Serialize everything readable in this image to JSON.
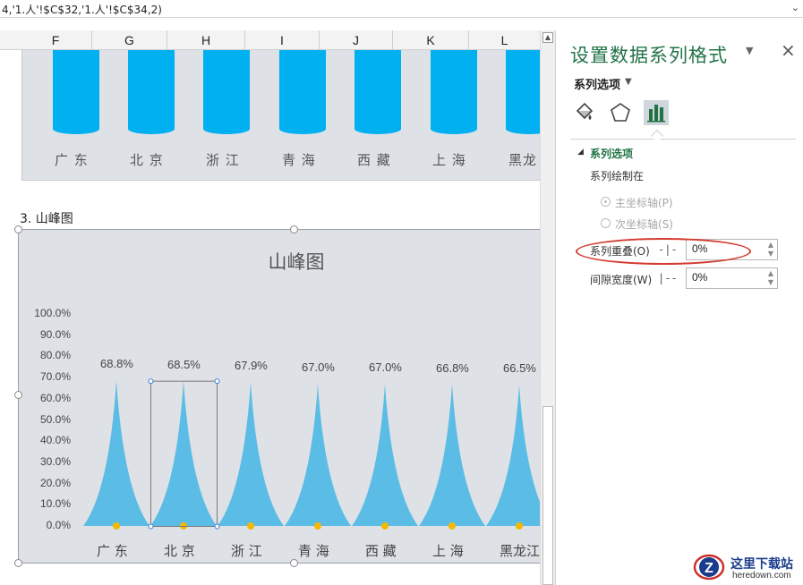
{
  "formula_bar": {
    "text": "4,'1.人'!$C$32,'1.人'!$C$34,2)"
  },
  "columns": [
    "F",
    "G",
    "H",
    "I",
    "J",
    "K",
    "L"
  ],
  "chart1": {
    "labels": [
      "广 东",
      "北 京",
      "浙 江",
      "青 海",
      "西 藏",
      "上 海",
      "黑龙"
    ]
  },
  "cell_label": "3. 山峰图",
  "chart_data": {
    "type": "area",
    "title": "山峰图",
    "categories": [
      "广 东",
      "北 京",
      "浙 江",
      "青 海",
      "西 藏",
      "上 海",
      "黑龙江"
    ],
    "values": [
      68.8,
      68.5,
      67.9,
      67.0,
      67.0,
      66.8,
      66.5
    ],
    "data_labels": [
      "68.8%",
      "68.5%",
      "67.9%",
      "67.0%",
      "67.0%",
      "66.8%",
      "66.5%"
    ],
    "y_ticks": [
      "0.0%",
      "10.0%",
      "20.0%",
      "30.0%",
      "40.0%",
      "50.0%",
      "60.0%",
      "70.0%",
      "80.0%",
      "90.0%",
      "100.0%"
    ],
    "ylim": [
      0,
      100
    ],
    "series_color": "#5bbde5",
    "marker_color": "#f5b800",
    "grid": false
  },
  "pane": {
    "title": "设置数据系列格式",
    "subtitle": "系列选项",
    "section_title": "系列选项",
    "plot_on_label": "系列绘制在",
    "primary_axis": "主坐标轴(P)",
    "secondary_axis": "次坐标轴(S)",
    "overlap_label": "系列重叠(O)",
    "overlap_value": "0%",
    "gap_label": "间隙宽度(W)",
    "gap_value": "0%",
    "accent": "#217346"
  },
  "watermark": {
    "cn": "这里下载站",
    "en": "heredown.com"
  }
}
